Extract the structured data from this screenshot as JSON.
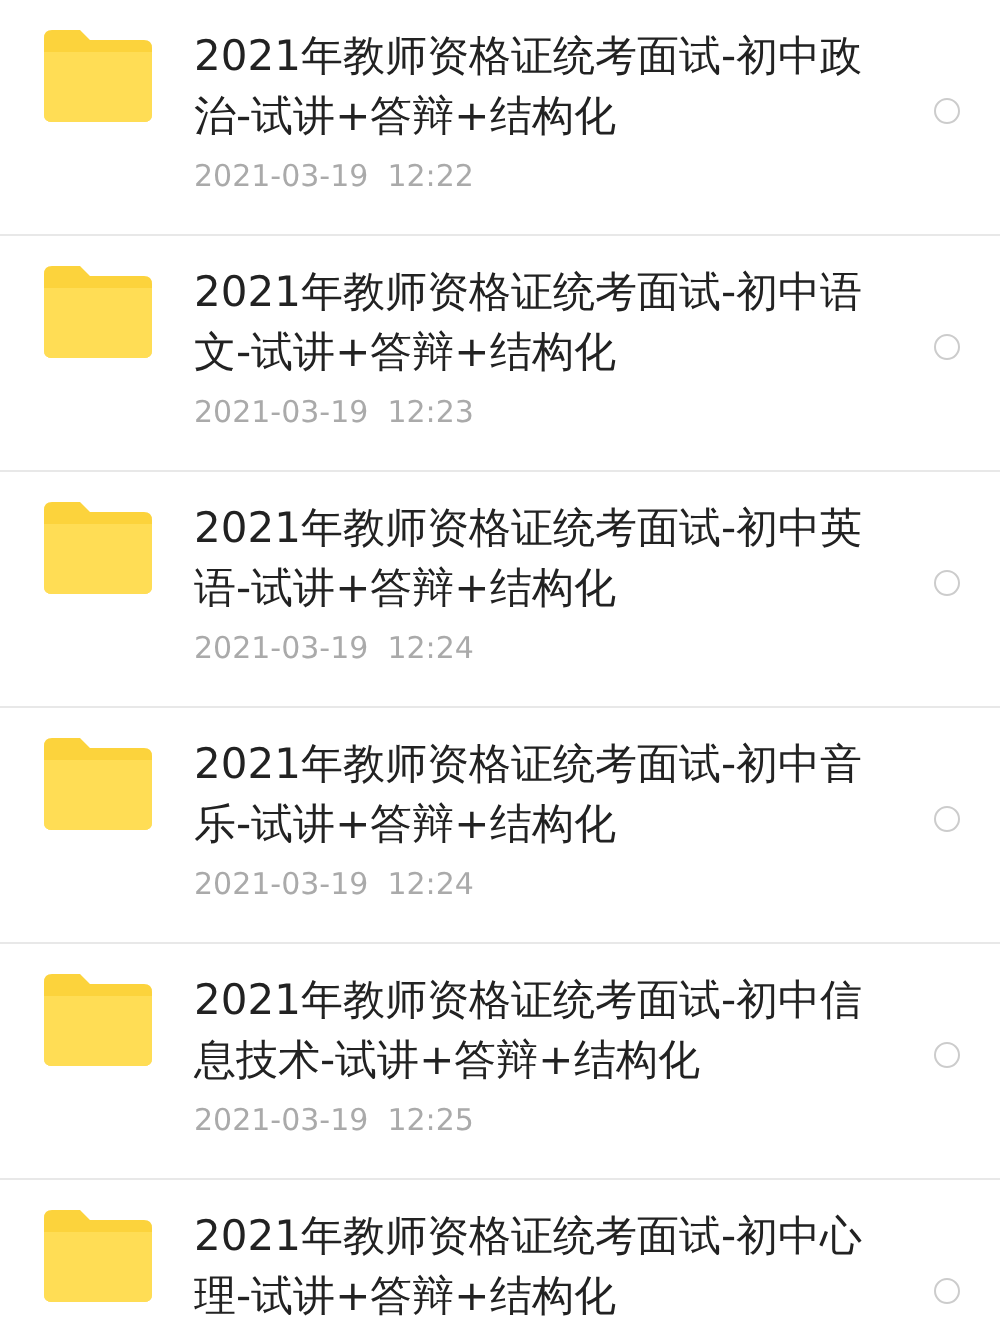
{
  "files": [
    {
      "title": "2021年教师资格证统考面试-初中政治-试讲+答辩+结构化",
      "date": "2021-03-19  12:22",
      "selected": false
    },
    {
      "title": "2021年教师资格证统考面试-初中语文-试讲+答辩+结构化",
      "date": "2021-03-19  12:23",
      "selected": false
    },
    {
      "title": "2021年教师资格证统考面试-初中英语-试讲+答辩+结构化",
      "date": "2021-03-19  12:24",
      "selected": false
    },
    {
      "title": "2021年教师资格证统考面试-初中音乐-试讲+答辩+结构化",
      "date": "2021-03-19  12:24",
      "selected": false
    },
    {
      "title": "2021年教师资格证统考面试-初中信息技术-试讲+答辩+结构化",
      "date": "2021-03-19  12:25",
      "selected": false
    },
    {
      "title": "2021年教师资格证统考面试-初中心理-试讲+答辩+结构化",
      "selected": false
    }
  ]
}
